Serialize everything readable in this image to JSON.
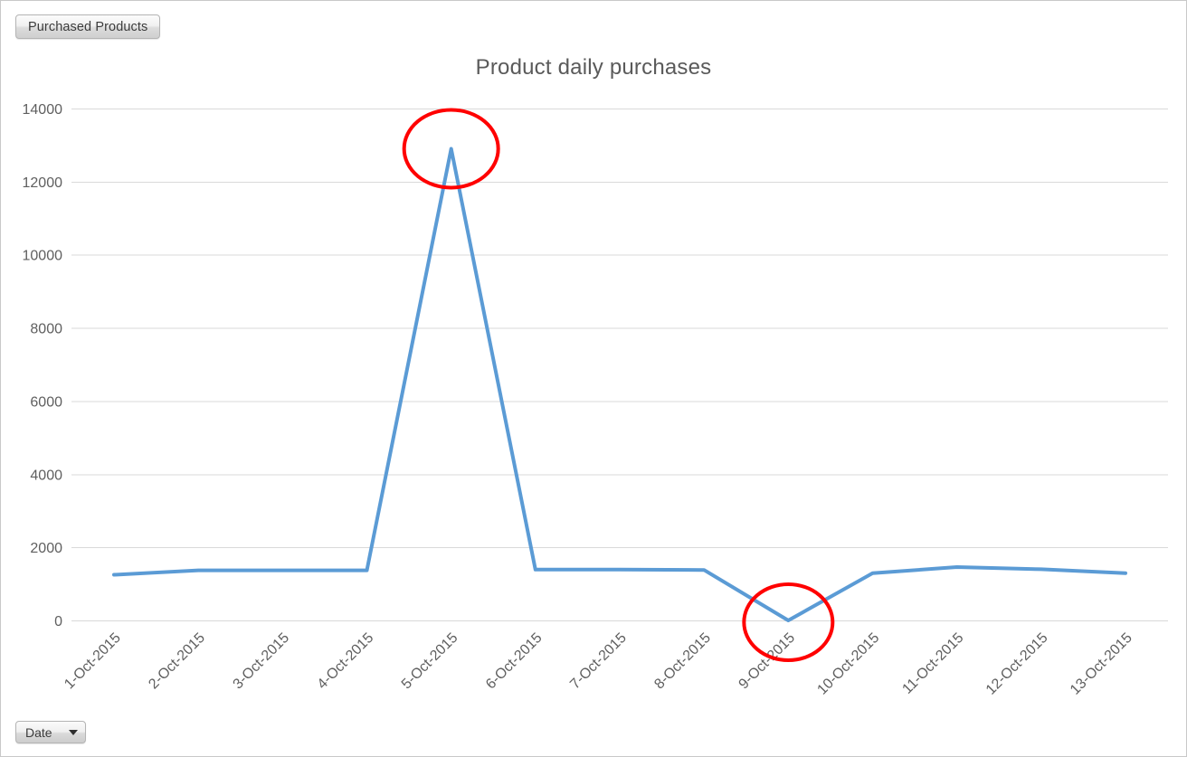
{
  "window": {
    "tab_label": "Purchased Products",
    "field_button_label": "Date",
    "caret_icon": "chevron-down-icon"
  },
  "colors": {
    "series_line": "#5B9BD5",
    "annotation": "#FF0000",
    "gridline": "#D9D9D9",
    "text": "#5F5F5F",
    "frame": "#C9C9C9"
  },
  "chart_data": {
    "type": "line",
    "title": "Product daily purchases",
    "xlabel": "",
    "ylabel": "",
    "grid": true,
    "legend": false,
    "ylim": [
      0,
      14000
    ],
    "yticks": [
      0,
      2000,
      4000,
      6000,
      8000,
      10000,
      12000,
      14000
    ],
    "ytick_labels": [
      "0",
      "2000",
      "4000",
      "6000",
      "8000",
      "10000",
      "12000",
      "14000"
    ],
    "categories": [
      "1-Oct-2015",
      "2-Oct-2015",
      "3-Oct-2015",
      "4-Oct-2015",
      "5-Oct-2015",
      "6-Oct-2015",
      "7-Oct-2015",
      "8-Oct-2015",
      "9-Oct-2015",
      "10-Oct-2015",
      "11-Oct-2015",
      "12-Oct-2015",
      "13-Oct-2015"
    ],
    "series": [
      {
        "name": "Purchased Products",
        "color": "#5B9BD5",
        "values": [
          1250,
          1370,
          1370,
          1370,
          12900,
          1390,
          1390,
          1380,
          0,
          1290,
          1460,
          1400,
          1290
        ]
      }
    ],
    "annotations": [
      {
        "shape": "ellipse",
        "label": "peak-highlight",
        "target_category": "5-Oct-2015",
        "target_value": 12900,
        "color": "#FF0000"
      },
      {
        "shape": "ellipse",
        "label": "zero-dip-highlight",
        "target_category": "9-Oct-2015",
        "target_value": 0,
        "color": "#FF0000"
      }
    ]
  }
}
